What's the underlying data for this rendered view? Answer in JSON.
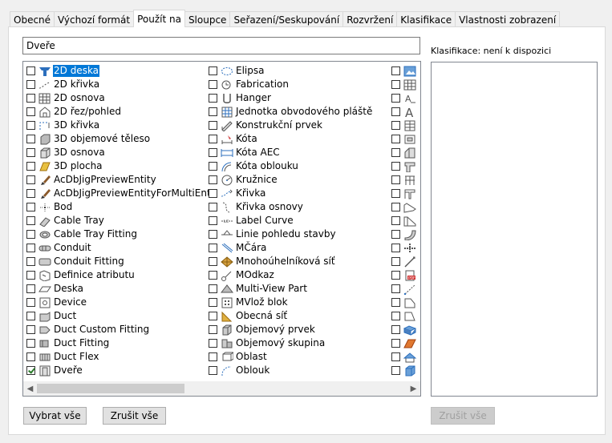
{
  "tabs": [
    {
      "label": "Obecné",
      "active": false
    },
    {
      "label": "Výchozí formát",
      "active": false
    },
    {
      "label": "Použít na",
      "active": true
    },
    {
      "label": "Sloupce",
      "active": false
    },
    {
      "label": "Seřazení/Seskupování",
      "active": false
    },
    {
      "label": "Rozvržení",
      "active": false
    },
    {
      "label": "Klasifikace",
      "active": false
    },
    {
      "label": "Vlastnosti zobrazení",
      "active": false
    }
  ],
  "filter": {
    "value": "Dveře"
  },
  "columns": [
    [
      {
        "label": "2D deska",
        "icon": "slab-2d-icon",
        "checked": false,
        "selected": true
      },
      {
        "label": "2D křivka",
        "icon": "curve-2d-icon",
        "checked": false
      },
      {
        "label": "2D osnova",
        "icon": "grid-2d-icon",
        "checked": false
      },
      {
        "label": "2D řez/pohled",
        "icon": "section-2d-icon",
        "checked": false
      },
      {
        "label": "3D křivka",
        "icon": "curve-3d-icon",
        "checked": false
      },
      {
        "label": "3D objemové těleso",
        "icon": "solid-3d-icon",
        "checked": false
      },
      {
        "label": "3D osnova",
        "icon": "grid-3d-icon",
        "checked": false
      },
      {
        "label": "3D plocha",
        "icon": "face-3d-icon",
        "checked": false
      },
      {
        "label": "AcDbJigPreviewEntity",
        "icon": "brush-icon",
        "checked": false
      },
      {
        "label": "AcDbJigPreviewEntityForMultiEnts",
        "icon": "brush-icon",
        "checked": false
      },
      {
        "label": "Bod",
        "icon": "point-icon",
        "checked": false
      },
      {
        "label": "Cable Tray",
        "icon": "cable-tray-icon",
        "checked": false
      },
      {
        "label": "Cable Tray Fitting",
        "icon": "cable-tray-fitting-icon",
        "checked": false
      },
      {
        "label": "Conduit",
        "icon": "conduit-icon",
        "checked": false
      },
      {
        "label": "Conduit Fitting",
        "icon": "conduit-fitting-icon",
        "checked": false
      },
      {
        "label": "Definice atributu",
        "icon": "attribute-icon",
        "checked": false
      },
      {
        "label": "Deska",
        "icon": "slab-icon",
        "checked": false
      },
      {
        "label": "Device",
        "icon": "device-icon",
        "checked": false
      },
      {
        "label": "Duct",
        "icon": "duct-icon",
        "checked": false
      },
      {
        "label": "Duct Custom Fitting",
        "icon": "duct-custom-fitting-icon",
        "checked": false
      },
      {
        "label": "Duct Fitting",
        "icon": "duct-fitting-icon",
        "checked": false
      },
      {
        "label": "Duct Flex",
        "icon": "duct-flex-icon",
        "checked": false
      },
      {
        "label": "Dveře",
        "icon": "door-icon",
        "checked": true
      }
    ],
    [
      {
        "label": "Elipsa",
        "icon": "ellipse-icon",
        "checked": false
      },
      {
        "label": "Fabrication",
        "icon": "fabrication-icon",
        "checked": false
      },
      {
        "label": "Hanger",
        "icon": "hanger-icon",
        "checked": false
      },
      {
        "label": "Jednotka obvodového pláště",
        "icon": "curtain-wall-unit-icon",
        "checked": false
      },
      {
        "label": "Konstrukční prvek",
        "icon": "structural-member-icon",
        "checked": false
      },
      {
        "label": "Kóta",
        "icon": "dimension-icon",
        "checked": false
      },
      {
        "label": "Kóta AEC",
        "icon": "aec-dimension-icon",
        "checked": false
      },
      {
        "label": "Kóta oblouku",
        "icon": "arc-dimension-icon",
        "checked": false
      },
      {
        "label": "Kružnice",
        "icon": "circle-icon",
        "checked": false
      },
      {
        "label": "Křivka",
        "icon": "curve-icon",
        "checked": false
      },
      {
        "label": "Křivka osnovy",
        "icon": "grid-curve-icon",
        "checked": false
      },
      {
        "label": "Label Curve",
        "icon": "label-curve-icon",
        "checked": false
      },
      {
        "label": "Linie pohledu stavby",
        "icon": "building-section-line-icon",
        "checked": false
      },
      {
        "label": "MČára",
        "icon": "mline-icon",
        "checked": false
      },
      {
        "label": "Mnohoúhelníková síť",
        "icon": "polyface-mesh-icon",
        "checked": false
      },
      {
        "label": "MOdkaz",
        "icon": "mleader-icon",
        "checked": false
      },
      {
        "label": "Multi-View Part",
        "icon": "multi-view-part-icon",
        "checked": false
      },
      {
        "label": "MVlož blok",
        "icon": "minsert-block-icon",
        "checked": false
      },
      {
        "label": "Obecná síť",
        "icon": "mesh-icon",
        "checked": false
      },
      {
        "label": "Objemový prvek",
        "icon": "mass-element-icon",
        "checked": false
      },
      {
        "label": "Objemový skupina",
        "icon": "mass-group-icon",
        "checked": false
      },
      {
        "label": "Oblast",
        "icon": "region-icon",
        "checked": false
      },
      {
        "label": "Oblouk",
        "icon": "arc-icon",
        "checked": false
      }
    ],
    [
      {
        "label": "",
        "icon": "image-icon",
        "checked": false
      },
      {
        "label": "",
        "icon": "table-icon",
        "checked": false
      },
      {
        "label": "",
        "icon": "text-icon",
        "checked": false
      },
      {
        "label": "",
        "icon": "mtext-icon",
        "checked": false
      },
      {
        "label": "",
        "icon": "window-grid-icon",
        "checked": false
      },
      {
        "label": "",
        "icon": "box-icon",
        "checked": false
      },
      {
        "label": "",
        "icon": "wall-corner-icon",
        "checked": false
      },
      {
        "label": "",
        "icon": "pipe-fitting-icon",
        "checked": false
      },
      {
        "label": "",
        "icon": "railing-icon",
        "checked": false
      },
      {
        "label": "",
        "icon": "frame-icon",
        "checked": false
      },
      {
        "label": "",
        "icon": "stair-icon",
        "checked": false
      },
      {
        "label": "",
        "icon": "stair-winder-icon",
        "checked": false
      },
      {
        "label": "",
        "icon": "pipe-bend-icon",
        "checked": false
      },
      {
        "label": "",
        "icon": "pipe-tee-icon",
        "checked": false
      },
      {
        "label": "",
        "icon": "line-diagonal-icon",
        "checked": false
      },
      {
        "label": "",
        "icon": "pdf-underlay-icon",
        "checked": false
      },
      {
        "label": "",
        "icon": "ray-icon",
        "checked": false
      },
      {
        "label": "",
        "icon": "shape-icon",
        "checked": false
      },
      {
        "label": "",
        "icon": "polygon-icon",
        "checked": false
      },
      {
        "label": "",
        "icon": "duct-blue-icon",
        "checked": false
      },
      {
        "label": "",
        "icon": "plane-orange-icon",
        "checked": false
      },
      {
        "label": "",
        "icon": "roof-slab-icon",
        "checked": false
      },
      {
        "label": "",
        "icon": "solid-blue-icon",
        "checked": false
      }
    ]
  ],
  "classification": {
    "label": "Klasifikace: není k dispozici"
  },
  "buttons": {
    "select_all": "Vybrat vše",
    "deselect_all": "Zrušit vše",
    "class_deselect": "Zrušit vše"
  }
}
